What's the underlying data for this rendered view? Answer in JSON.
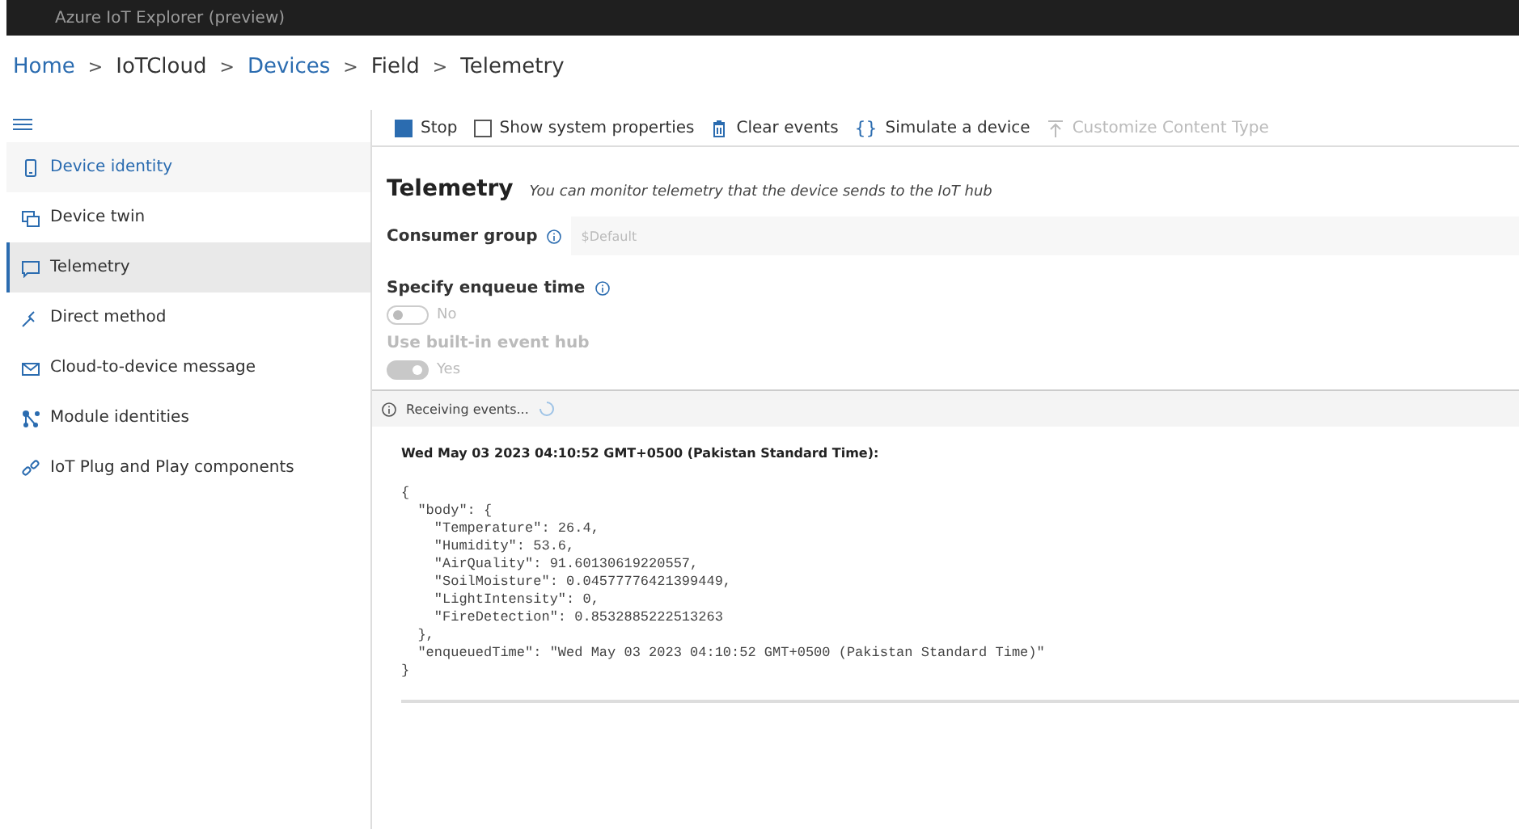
{
  "window": {
    "title": "Azure IoT Explorer (preview)"
  },
  "breadcrumb": [
    {
      "label": "Home",
      "link": true
    },
    {
      "label": "IoTCloud",
      "link": false
    },
    {
      "label": "Devices",
      "link": true
    },
    {
      "label": "Field",
      "link": false
    },
    {
      "label": "Telemetry",
      "link": false
    }
  ],
  "breadcrumb_separator": ">",
  "sidebar": {
    "items": [
      {
        "label": "Device identity",
        "kind": "phone",
        "selected": false,
        "highlighted": true
      },
      {
        "label": "Device twin",
        "kind": "twin",
        "selected": false,
        "highlighted": false
      },
      {
        "label": "Telemetry",
        "kind": "chat",
        "selected": true,
        "highlighted": false
      },
      {
        "label": "Direct method",
        "kind": "method",
        "selected": false,
        "highlighted": false
      },
      {
        "label": "Cloud-to-device message",
        "kind": "mail",
        "selected": false,
        "highlighted": false
      },
      {
        "label": "Module identities",
        "kind": "modules",
        "selected": false,
        "highlighted": false
      },
      {
        "label": "IoT Plug and Play components",
        "kind": "plug",
        "selected": false,
        "highlighted": false
      }
    ]
  },
  "toolbar": [
    {
      "kind": "stop",
      "label": "Stop",
      "disabled": false
    },
    {
      "kind": "checkbox",
      "label": "Show system properties",
      "checked": false,
      "disabled": false
    },
    {
      "kind": "trash",
      "label": "Clear events",
      "disabled": false
    },
    {
      "kind": "braces",
      "label": "Simulate a device",
      "icon_text": "{}",
      "disabled": false
    },
    {
      "kind": "upload",
      "label": "Customize Content Type",
      "disabled": true
    }
  ],
  "heading": {
    "title": "Telemetry",
    "subtitle": "You can monitor telemetry that the device sends to the IoT hub"
  },
  "consumer_group": {
    "label": "Consumer group",
    "placeholder": "$Default"
  },
  "toggles": [
    {
      "label": "Specify enqueue time",
      "info": true,
      "label_disabled": false,
      "on": false,
      "state_text": "No",
      "disabled": true
    },
    {
      "label": "Use built-in event hub",
      "info": false,
      "label_disabled": true,
      "on": true,
      "state_text": "Yes",
      "disabled": true
    }
  ],
  "status": {
    "text": "Receiving events..."
  },
  "events": [
    {
      "timestamp": "Wed May 03 2023 04:10:52 GMT+0500 (Pakistan Standard Time):",
      "body": "{\n  \"body\": {\n    \"Temperature\": 26.4,\n    \"Humidity\": 53.6,\n    \"AirQuality\": 91.60130619220557,\n    \"SoilMoisture\": 0.04577776421399449,\n    \"LightIntensity\": 0,\n    \"FireDetection\": 0.8532885222513263\n  },\n  \"enqueuedTime\": \"Wed May 03 2023 04:10:52 GMT+0500 (Pakistan Standard Time)\"\n}"
    }
  ]
}
